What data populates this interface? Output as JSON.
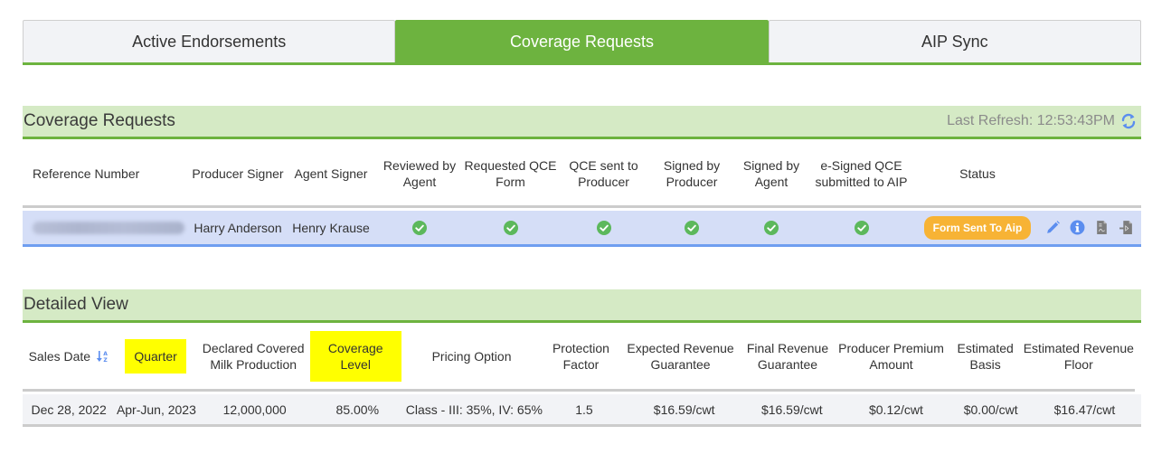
{
  "tabs": [
    {
      "label": "Active Endorsements",
      "active": false
    },
    {
      "label": "Coverage Requests",
      "active": true
    },
    {
      "label": "AIP Sync",
      "active": false
    }
  ],
  "colors": {
    "accent_green": "#6db33f",
    "section_bg": "#d5eac5",
    "row_selected_bg": "#d5def7",
    "row_selected_border": "#6f9ef0",
    "status_badge": "#f7b335",
    "check": "#5cb85c",
    "icon_blue": "#5b8def",
    "highlight": "#ffff00"
  },
  "coverage_requests": {
    "title": "Coverage Requests",
    "last_refresh_label": "Last Refresh: 12:53:43PM",
    "refresh_icon": "refresh-icon",
    "columns": [
      "Reference Number",
      "Producer Signer",
      "Agent Signer",
      "Reviewed by Agent",
      "Requested QCE Form",
      "QCE sent to Producer",
      "Signed by Producer",
      "Signed by Agent",
      "e-Signed QCE submitted to AIP",
      "Status"
    ],
    "rows": [
      {
        "reference_number": "[redacted]",
        "producer_signer": "Harry Anderson",
        "agent_signer": "Henry Krause",
        "reviewed_by_agent": true,
        "requested_qce_form": true,
        "qce_sent_to_producer": true,
        "signed_by_producer": true,
        "signed_by_agent": true,
        "esigned_qce_submitted": true,
        "status": "Form Sent To Aip",
        "actions": [
          "edit-icon",
          "info-icon",
          "pdf-document-icon",
          "export-document-icon"
        ]
      }
    ]
  },
  "detailed_view": {
    "title": "Detailed View",
    "columns": [
      {
        "label": "Sales Date",
        "sortable": true,
        "highlighted": false
      },
      {
        "label": "Quarter",
        "sortable": false,
        "highlighted": true
      },
      {
        "label": "Declared Covered Milk Production",
        "sortable": false,
        "highlighted": false
      },
      {
        "label": "Coverage Level",
        "sortable": false,
        "highlighted": true
      },
      {
        "label": "Pricing Option",
        "sortable": false,
        "highlighted": false
      },
      {
        "label": "Protection Factor",
        "sortable": false,
        "highlighted": false
      },
      {
        "label": "Expected Revenue Guarantee",
        "sortable": false,
        "highlighted": false
      },
      {
        "label": "Final Revenue Guarantee",
        "sortable": false,
        "highlighted": false
      },
      {
        "label": "Producer Premium Amount",
        "sortable": false,
        "highlighted": false
      },
      {
        "label": "Estimated Basis",
        "sortable": false,
        "highlighted": false
      },
      {
        "label": "Estimated Revenue Floor",
        "sortable": false,
        "highlighted": false
      }
    ],
    "rows": [
      [
        "Dec 28, 2022",
        "Apr-Jun, 2023",
        "12,000,000",
        "85.00%",
        "Class - III: 35%, IV: 65%",
        "1.5",
        "$16.59/cwt",
        "$16.59/cwt",
        "$0.12/cwt",
        "$0.00/cwt",
        "$16.47/cwt"
      ]
    ]
  }
}
